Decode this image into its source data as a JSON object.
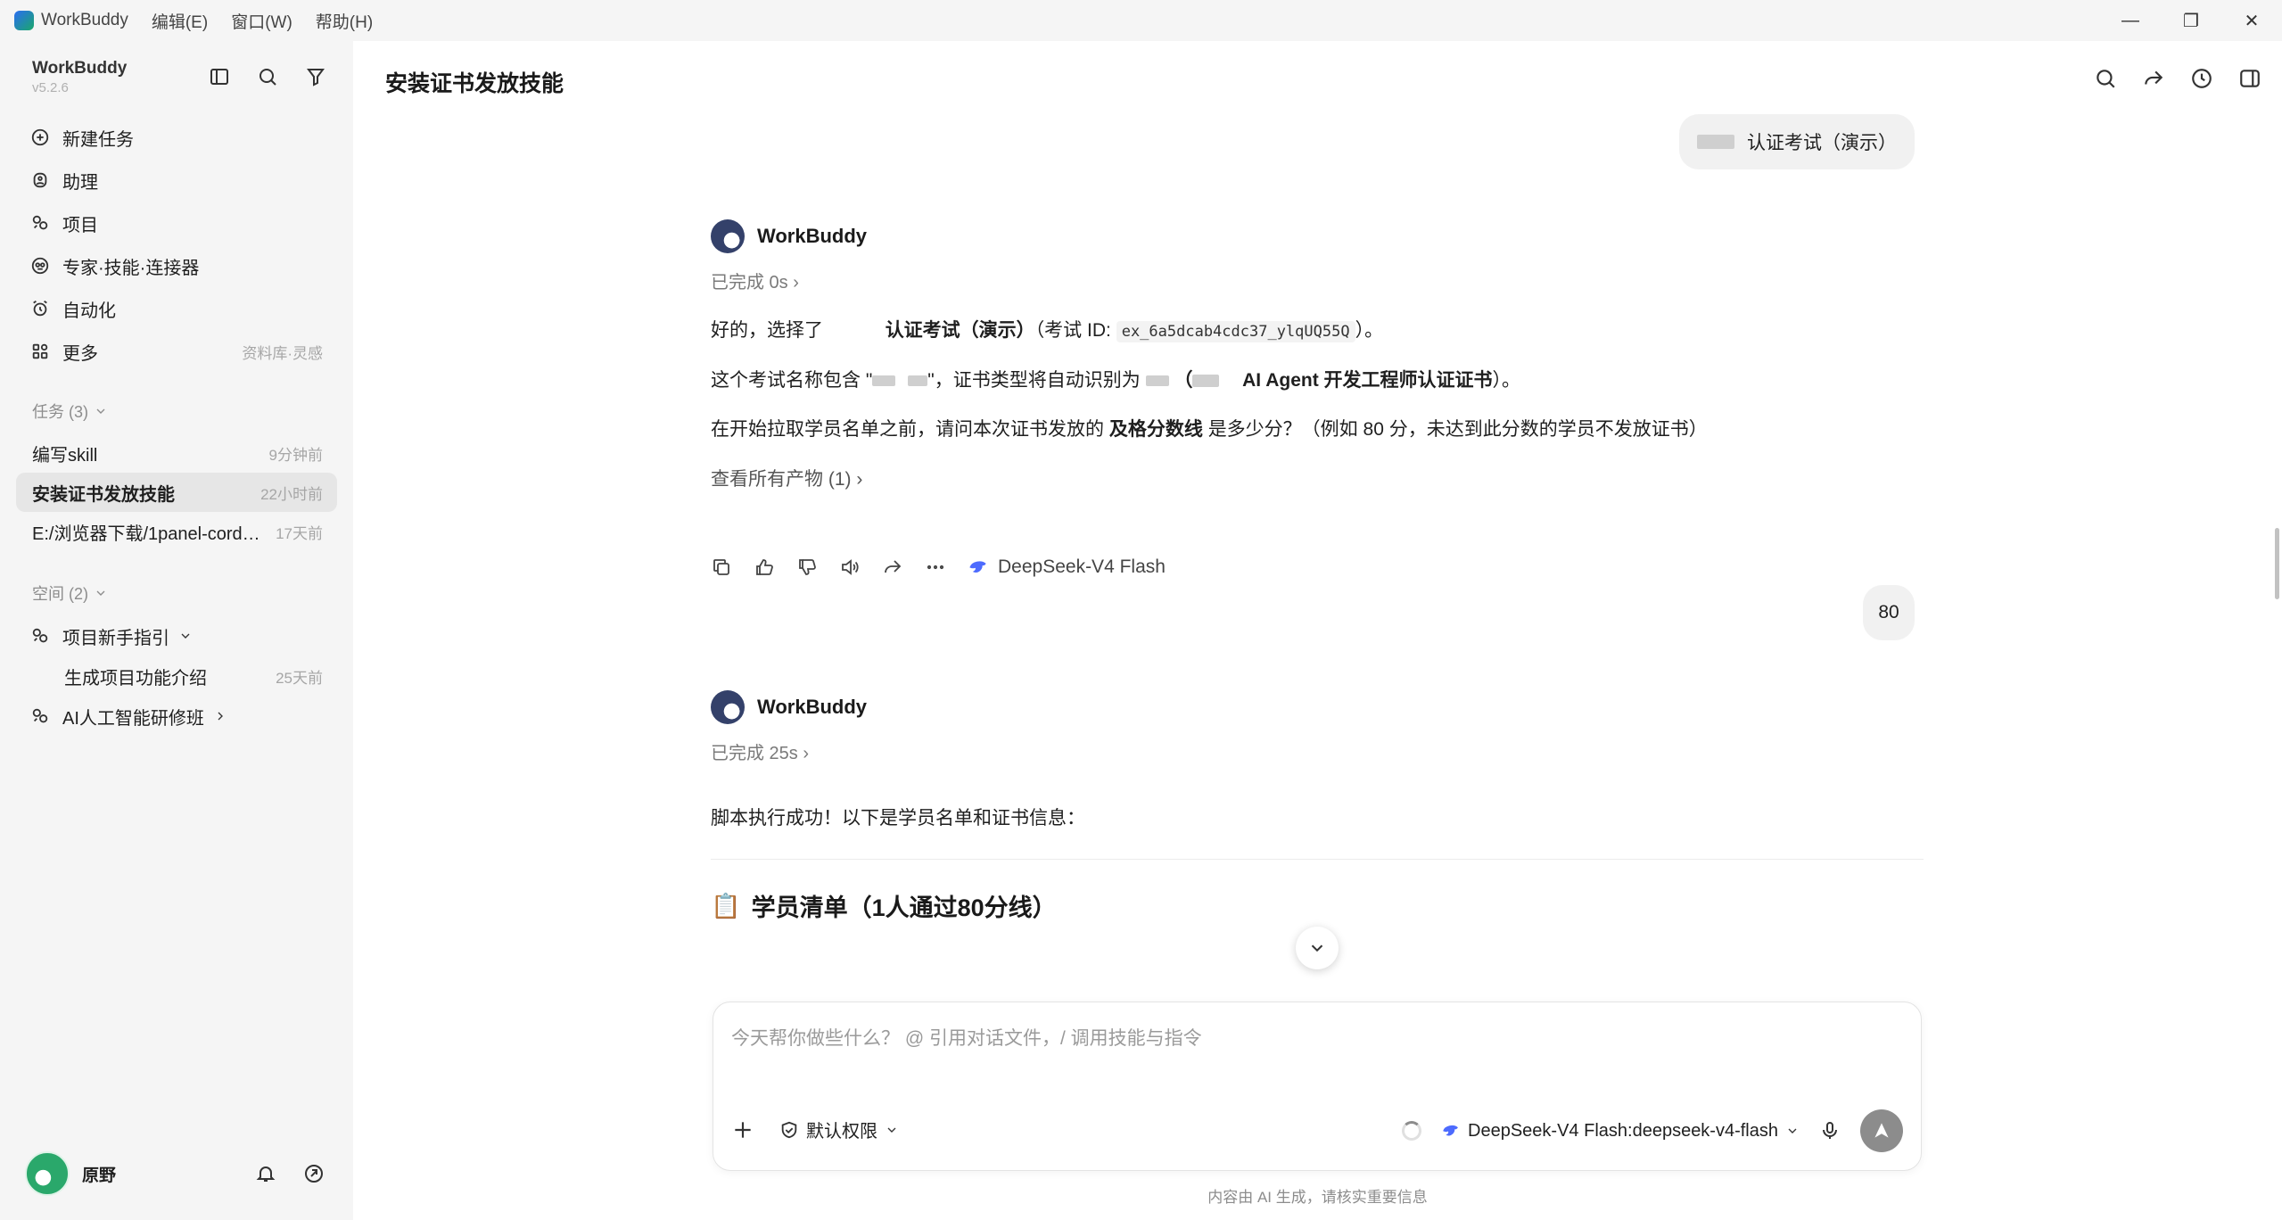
{
  "titlebar": {
    "app_name": "WorkBuddy",
    "menus": [
      "编辑(E)",
      "窗口(W)",
      "帮助(H)"
    ],
    "controls": [
      "—",
      "❐",
      "✕"
    ]
  },
  "sidebar": {
    "brand": "WorkBuddy",
    "version": "v5.2.6",
    "nav": [
      {
        "label": "新建任务",
        "icon": "plus-circle-icon"
      },
      {
        "label": "助理",
        "icon": "assistant-icon"
      },
      {
        "label": "项目",
        "icon": "project-icon"
      },
      {
        "label": "专家·技能·连接器",
        "icon": "expert-icon"
      },
      {
        "label": "自动化",
        "icon": "alarm-clock-icon"
      },
      {
        "label": "更多",
        "icon": "apps-icon",
        "sub": "资料库·灵感"
      }
    ],
    "tasks_label": "任务 (3)",
    "tasks": [
      {
        "label": "编写skill",
        "time": "9分钟前"
      },
      {
        "label": "安装证书发放技能",
        "time": "22小时前"
      },
      {
        "label": "E:/浏览器下载/1panel-cordy...",
        "time": "17天前"
      }
    ],
    "spaces_label": "空间 (2)",
    "spaces": [
      {
        "label": "项目新手指引"
      },
      {
        "label": "生成项目功能介绍",
        "time": "25天前"
      },
      {
        "label": "AI人工智能研修班"
      }
    ],
    "user_name": "原野"
  },
  "main": {
    "title": "安装证书发放技能",
    "user_msg_1": "认证考试（演示）",
    "bot_name": "WorkBuddy",
    "done_1": "已完成 0s",
    "p1_pre": "好的，选择了",
    "p1_bold": "认证考试（演示）",
    "p1_mid": "（考试 ID:",
    "p1_code": "ex_6a5dcab4cdc37_ylqUQ55Q",
    "p1_end": "）。",
    "p2_a": "这个考试名称包含 \"",
    "p2_b": "\"，证书类型将自动识别为",
    "p2_c": "（",
    "p2_bold": "AI Agent 开发工程师认证证书",
    "p2_end": "）。",
    "p3_a": "在开始拉取学员名单之前，请问本次证书发放的",
    "p3_bold": "及格分数线",
    "p3_b": "是多少分？（例如 80 分，未达到此分数的学员不发放证书）",
    "artifacts": "查看所有产物 (1)",
    "model_name": "DeepSeek-V4 Flash",
    "user_msg_2": "80",
    "done_2": "已完成 25s",
    "p4": "脚本执行成功！以下是学员名单和证书信息：",
    "section_emoji": "📋",
    "section_title": "学员清单（1人通过80分线）"
  },
  "composer": {
    "placeholder": "今天帮你做些什么？ @ 引用对话文件，/ 调用技能与指令",
    "permission": "默认权限",
    "model": "DeepSeek-V4 Flash:deepseek-v4-flash"
  },
  "footnote": "内容由 AI 生成，请核实重要信息",
  "colors": {
    "sidebar_bg": "#f5f5f5",
    "active_item": "#e6e6e6",
    "deepseek_blue": "#4d6bfe"
  }
}
